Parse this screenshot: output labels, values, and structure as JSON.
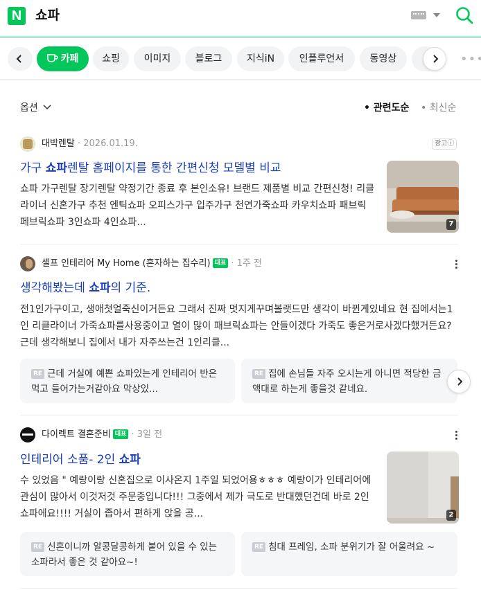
{
  "header": {
    "logo": "N",
    "query": "쇼파",
    "icons": [
      "keyboard-icon",
      "caret-down-icon",
      "search-icon"
    ]
  },
  "tabs": {
    "items": [
      {
        "label": "카페",
        "active": true
      },
      {
        "label": "쇼핑"
      },
      {
        "label": "이미지"
      },
      {
        "label": "블로그"
      },
      {
        "label": "지식iN"
      },
      {
        "label": "인플루언서"
      },
      {
        "label": "동영상"
      }
    ]
  },
  "options": {
    "label": "옵션",
    "sort_relevance": "• 관련도순",
    "sort_recent": "• 최신순"
  },
  "results": [
    {
      "source": "대박렌탈",
      "date": "2026.01.19.",
      "ad_label": "광고ⓘ",
      "title_pre": "가구 ",
      "title_hl": "쇼파",
      "title_post": "렌탈 홈페이지를 통한 간편신청 모델별 비교",
      "desc": "쇼파 가구렌탈 장기렌탈 약정기간 종료 후 본인소유! 브랜드 제품별 비교 간편신청! 리클라이너 신혼가구 추천 엔틱쇼파 오피스가구 입주가구 천연가죽쇼파 카우치쇼파 패브릭 페브릭쇼파 3인쇼파 4인쇼파...",
      "thumb_count": "7"
    },
    {
      "source": "셀프 인테리어 My Home (혼자하는 집수리)",
      "badge": "대표",
      "date": "1주 전",
      "title_pre": "생각해봤는데 ",
      "title_hl": "쇼파",
      "title_post": "의 기준.",
      "desc": "전1인가구이고, 생애첫얼죽신이거든요 그래서 진짜 멋지게꾸며볼랫드만 생각이 바뀐게있네요 현 집에서는1인 리클라이너 가죽쇼파를사용중이고 열이 많이 패브릭쇼파는 안들이겠다 가죽도 좋은거로사겠다했거든요? 근데 생각해보니 집에서 내가 자주쓰는건 1인리클...",
      "replies": [
        {
          "tag": "RE",
          "text": "근데 거실에 예쁜 쇼파있는게 인테리어 반은 먹고 들어가는거같아요 막상있..."
        },
        {
          "tag": "RE",
          "text": "집에 손님들 자주 오시는게 아니면 적당한 금액대로 하는게 좋을것 같네요."
        }
      ]
    },
    {
      "source": "다이렉트 결혼준비",
      "badge": "대표",
      "date": "3일 전",
      "title_pre": "인테리어 소품- 2인 ",
      "title_hl": "쇼파",
      "title_post": "",
      "desc": "수 있었음 \" 예랑이랑 신혼집으로 이사온지 1주일 되었어용ㅎㅎㅎ 예랑이가 인테리어에 관심이 많아서 이것저것 주문중입니다!!! 그중에서 제가 극도로 반대했던건데 바로 2인 쇼파에요!!!! 거실이 좁아서 편하게 앉을 공...",
      "thumb_count": "2",
      "replies": [
        {
          "tag": "RE",
          "text": "신혼이니까 알콩달콩하게 붙어 있을 수 있는 소파라서 좋은 것 같아요~!"
        },
        {
          "tag": "RE",
          "text": "침대 프레임, 소파 분위기가 잘 어울려요 ~"
        }
      ]
    }
  ],
  "colors": {
    "brand": "#03c75a",
    "title": "#1a3fb5"
  }
}
